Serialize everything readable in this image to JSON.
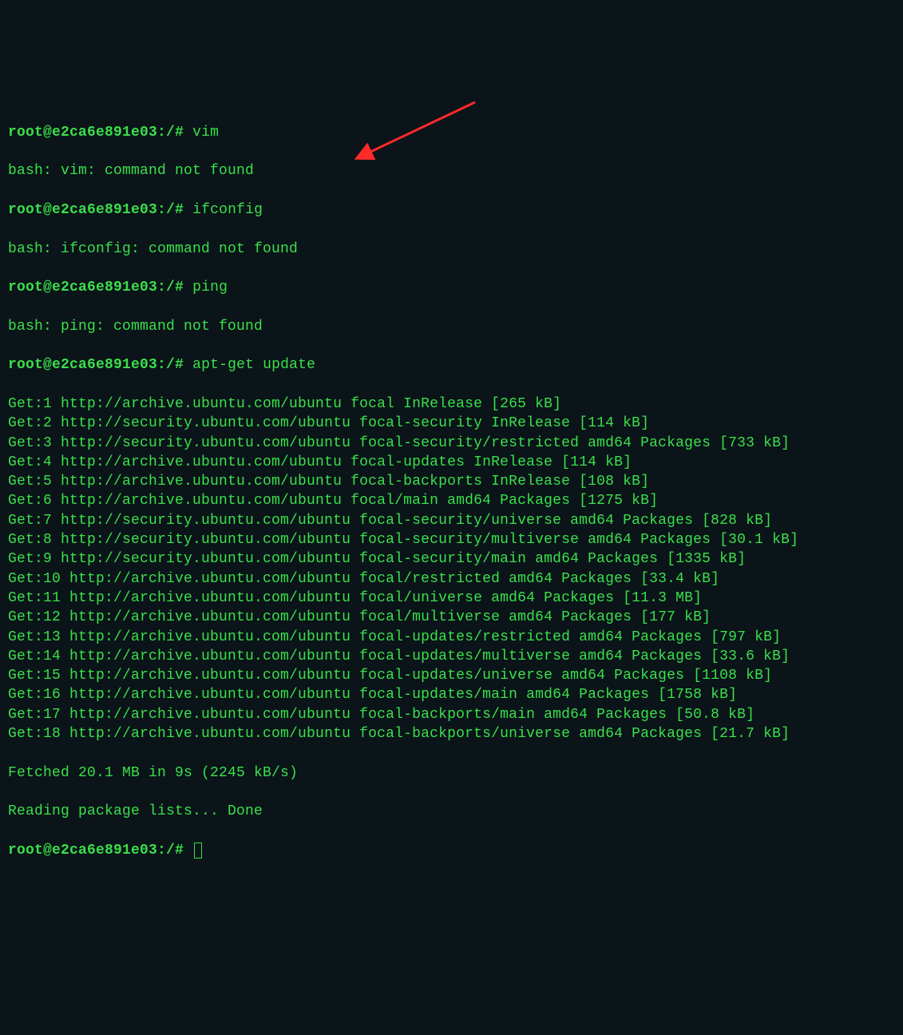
{
  "prompt": "root@e2ca6e891e03:/#",
  "commands": {
    "vim": "vim",
    "ifconfig": "ifconfig",
    "ping": "ping",
    "apt_update": "apt-get update"
  },
  "errors": {
    "vim": "bash: vim: command not found",
    "ifconfig": "bash: ifconfig: command not found",
    "ping": "bash: ping: command not found"
  },
  "apt_lines": [
    "Get:1 http://archive.ubuntu.com/ubuntu focal InRelease [265 kB]",
    "Get:2 http://security.ubuntu.com/ubuntu focal-security InRelease [114 kB]",
    "Get:3 http://security.ubuntu.com/ubuntu focal-security/restricted amd64 Packages [733 kB]",
    "Get:4 http://archive.ubuntu.com/ubuntu focal-updates InRelease [114 kB]",
    "Get:5 http://archive.ubuntu.com/ubuntu focal-backports InRelease [108 kB]",
    "Get:6 http://archive.ubuntu.com/ubuntu focal/main amd64 Packages [1275 kB]",
    "Get:7 http://security.ubuntu.com/ubuntu focal-security/universe amd64 Packages [828 kB]",
    "Get:8 http://security.ubuntu.com/ubuntu focal-security/multiverse amd64 Packages [30.1 kB]",
    "Get:9 http://security.ubuntu.com/ubuntu focal-security/main amd64 Packages [1335 kB]",
    "Get:10 http://archive.ubuntu.com/ubuntu focal/restricted amd64 Packages [33.4 kB]",
    "Get:11 http://archive.ubuntu.com/ubuntu focal/universe amd64 Packages [11.3 MB]",
    "Get:12 http://archive.ubuntu.com/ubuntu focal/multiverse amd64 Packages [177 kB]",
    "Get:13 http://archive.ubuntu.com/ubuntu focal-updates/restricted amd64 Packages [797 kB]",
    "Get:14 http://archive.ubuntu.com/ubuntu focal-updates/multiverse amd64 Packages [33.6 kB]",
    "Get:15 http://archive.ubuntu.com/ubuntu focal-updates/universe amd64 Packages [1108 kB]",
    "Get:16 http://archive.ubuntu.com/ubuntu focal-updates/main amd64 Packages [1758 kB]",
    "Get:17 http://archive.ubuntu.com/ubuntu focal-backports/main amd64 Packages [50.8 kB]",
    "Get:18 http://archive.ubuntu.com/ubuntu focal-backports/universe amd64 Packages [21.7 kB]"
  ],
  "footer": {
    "fetched": "Fetched 20.1 MB in 9s (2245 kB/s)",
    "reading": "Reading package lists... Done"
  },
  "annotation": {
    "type": "arrow",
    "color": "#ff2a2a"
  }
}
